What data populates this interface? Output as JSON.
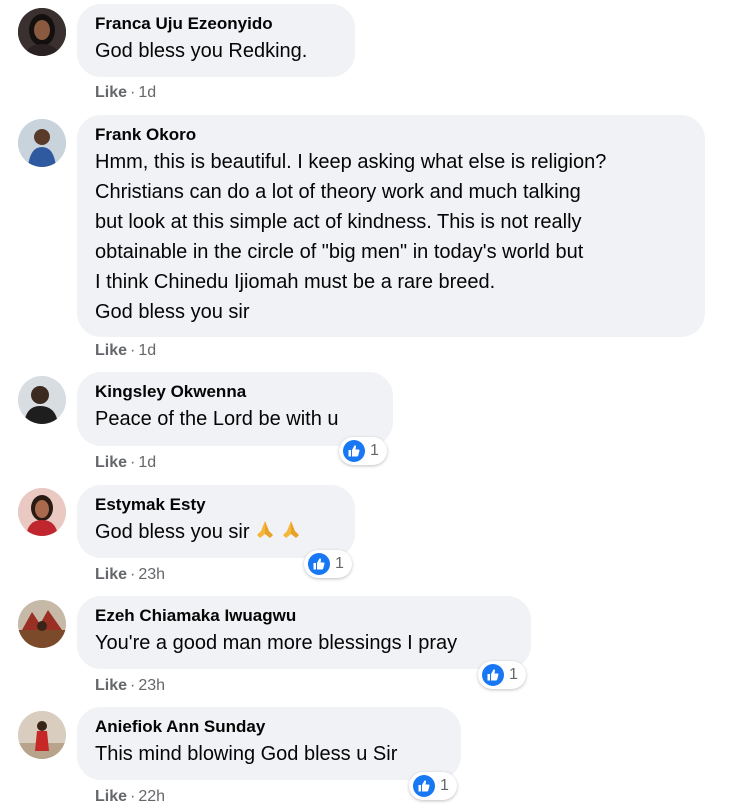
{
  "like_label": "Like",
  "separator": "·",
  "accent_color": "#1877f2",
  "comments": [
    {
      "author": "Franca Uju Ezeonyido",
      "text": "God bless you Redking.",
      "time": "1d",
      "avatar_icon": "avatar-woman-icon"
    },
    {
      "author": "Frank Okoro",
      "text": "Hmm, this is beautiful. I keep asking what else is religion?\nChristians can do a lot of theory work and much talking\nbut look at this simple act of kindness. This is not really\nobtainable in the circle of \"big men\" in today's world but\nI think Chinedu Ijiomah must be a rare breed.\nGod bless you sir",
      "time": "1d",
      "avatar_icon": "avatar-man-icon"
    },
    {
      "author": "Kingsley Okwenna",
      "text": "Peace of the Lord be with u",
      "time": "1d",
      "avatar_icon": "avatar-man-icon",
      "reaction": {
        "icon": "like-reaction-icon",
        "count": "1"
      }
    },
    {
      "author": "Estymak Esty",
      "text": "God bless you sir",
      "emojis": [
        "folded-hands-emoji",
        "folded-hands-emoji"
      ],
      "time": "23h",
      "avatar_icon": "avatar-woman-icon",
      "reaction": {
        "icon": "like-reaction-icon",
        "count": "1"
      }
    },
    {
      "author": "Ezeh Chiamaka Iwuagwu",
      "text": "You're a good man more blessings I pray",
      "time": "23h",
      "avatar_icon": "avatar-photo-icon",
      "reaction": {
        "icon": "like-reaction-icon",
        "count": "1"
      }
    },
    {
      "author": "Aniefiok Ann Sunday",
      "text": "This mind blowing God bless u Sir",
      "time": "22h",
      "avatar_icon": "avatar-person-icon",
      "reaction": {
        "icon": "like-reaction-icon",
        "count": "1"
      }
    }
  ]
}
